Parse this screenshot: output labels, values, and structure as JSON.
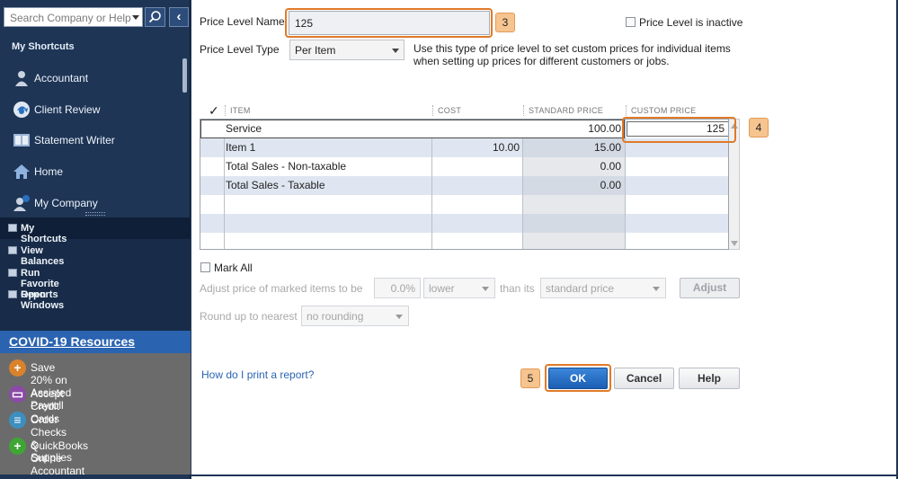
{
  "sidebar": {
    "search_placeholder": "Search Company or Help",
    "collapse_glyph": "‹",
    "shortcuts_header": "My Shortcuts",
    "shortcuts": [
      {
        "label": "Accountant",
        "icon": "person-icon"
      },
      {
        "label": "Client Review",
        "icon": "client-review-icon"
      },
      {
        "label": "Statement Writer",
        "icon": "statement-writer-icon"
      },
      {
        "label": "Home",
        "icon": "home-icon"
      },
      {
        "label": "My Company",
        "icon": "my-company-icon"
      }
    ],
    "nav": [
      {
        "label": "My Shortcuts"
      },
      {
        "label": "View Balances"
      },
      {
        "label": "Run Favorite Reports"
      },
      {
        "label": "Open Windows"
      }
    ],
    "covid_header": "COVID-19 Resources",
    "covid_items": [
      {
        "label": "Save 20% on Assisted Payroll",
        "icon": "plus-icon",
        "color": "#d9822b"
      },
      {
        "label": "Accept Credit Cards",
        "icon": "credit-card-icon",
        "color": "#8b4aa8"
      },
      {
        "label": "Order Checks & Supplies",
        "icon": "checks-icon",
        "color": "#3d8fc0"
      },
      {
        "label": "QuickBooks Online Accountant",
        "icon": "plus-icon",
        "color": "#3fa535"
      }
    ]
  },
  "form": {
    "price_level_name_label": "Price Level Name",
    "price_level_name_value": "125",
    "inactive_label": "Price Level is inactive",
    "price_level_type_label": "Price Level Type",
    "price_level_type_value": "Per Item",
    "type_description": "Use this type of price level to set custom prices for individual items when setting up prices for different customers or jobs.",
    "table": {
      "headers": {
        "check": "✓",
        "item": "ITEM",
        "cost": "COST",
        "standard_price": "STANDARD PRICE",
        "custom_price": "CUSTOM PRICE"
      },
      "rows": [
        {
          "item": "Service",
          "cost": "",
          "standard_price": "100.00",
          "custom_price": "125"
        },
        {
          "item": "Item 1",
          "cost": "10.00",
          "standard_price": "15.00",
          "custom_price": ""
        },
        {
          "item": "Total Sales - Non-taxable",
          "cost": "",
          "standard_price": "0.00",
          "custom_price": ""
        },
        {
          "item": "Total Sales - Taxable",
          "cost": "",
          "standard_price": "0.00",
          "custom_price": ""
        }
      ]
    },
    "mark_all_label": "Mark All",
    "adjust_label": "Adjust price of marked items to be",
    "adjust_percent": "0.0%",
    "adjust_direction": "lower",
    "than_its_label": "than its",
    "adjust_basis": "standard price",
    "adjust_button": "Adjust",
    "round_label": "Round up to nearest",
    "round_value": "no rounding",
    "help_link": "How do I print a report?",
    "ok_button": "OK",
    "cancel_button": "Cancel",
    "help_button": "Help"
  },
  "callouts": {
    "name": "3",
    "custom_price": "4",
    "ok": "5"
  },
  "colors": {
    "callout_border": "#e07a28",
    "callout_fill": "#f6c48f",
    "sidebar_bg": "#1e3556",
    "covid_header_bg": "#2a63b0",
    "ok_blue": "#1b5fb3"
  }
}
